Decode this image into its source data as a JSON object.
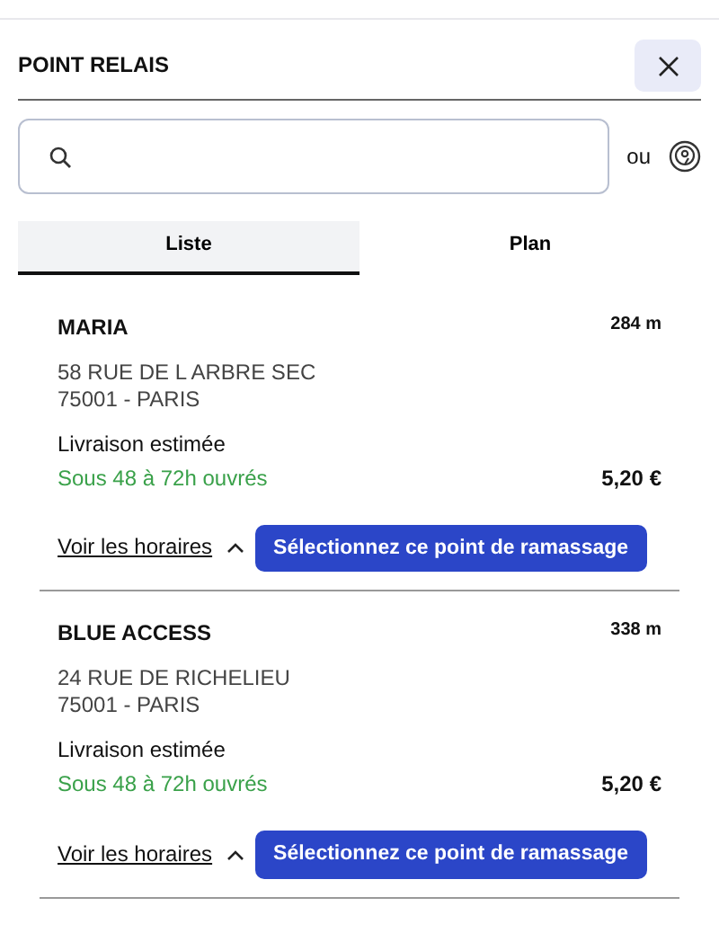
{
  "header": {
    "title": "POINT RELAIS"
  },
  "search": {
    "separator": "ou"
  },
  "tabs": [
    {
      "label": "Liste",
      "selected": true
    },
    {
      "label": "Plan",
      "selected": false
    }
  ],
  "points": [
    {
      "name": "MARIA",
      "distance": "284 m",
      "address": [
        "58 RUE DE L ARBRE SEC",
        "75001 - PARIS"
      ],
      "delivery_label": "Livraison estimée",
      "delivery_time": "Sous 48 à 72h ouvrés",
      "price": "5,20 €",
      "hours_link": "Voir les horaires",
      "expanded": true,
      "action": "Sélectionnez ce point de ramassage"
    },
    {
      "name": "BLUE ACCESS",
      "distance": "338 m",
      "address": [
        "24 RUE DE RICHELIEU",
        "75001 - PARIS"
      ],
      "delivery_label": "Livraison estimée",
      "delivery_time": "Sous 48 à 72h ouvrés",
      "price": "5,20 €",
      "hours_link": "Voir les horaires",
      "expanded": true,
      "action": "Sélectionnez ce point de ramassage"
    }
  ]
}
